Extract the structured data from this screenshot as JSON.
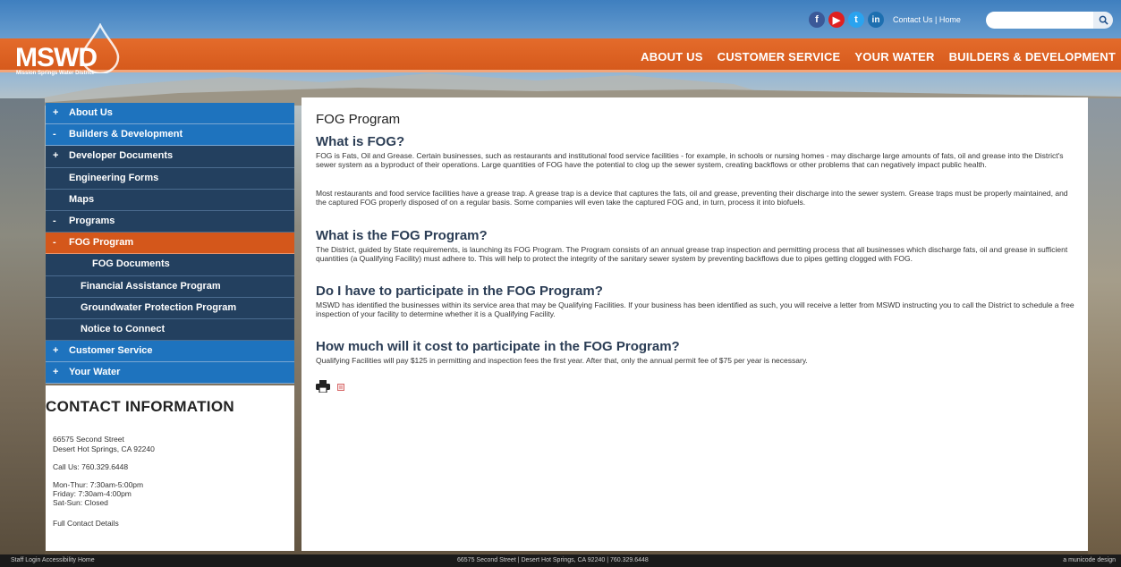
{
  "logo": {
    "main": "MSWD",
    "sub": "Mission Springs Water District"
  },
  "topbar": {
    "social": [
      "f",
      "▶",
      "t",
      "in"
    ],
    "contact_label": "Contact Us",
    "separator": "|",
    "home_label": "Home",
    "search_placeholder": ""
  },
  "nav": [
    "ABOUT US",
    "CUSTOMER SERVICE",
    "YOUR WATER",
    "BUILDERS & DEVELOPMENT"
  ],
  "sidebar": [
    {
      "mark": "+",
      "label": "About Us"
    },
    {
      "mark": "-",
      "label": "Builders & Development"
    },
    {
      "mark": "+",
      "label": "Developer Documents"
    },
    {
      "mark": "",
      "label": "Engineering Forms"
    },
    {
      "mark": "",
      "label": "Maps"
    },
    {
      "mark": "-",
      "label": "Programs"
    },
    {
      "mark": "-",
      "label": "FOG Program"
    },
    {
      "mark": "",
      "label": "FOG Documents"
    },
    {
      "mark": "",
      "label": "Financial Assistance Program"
    },
    {
      "mark": "",
      "label": "Groundwater Protection Program"
    },
    {
      "mark": "",
      "label": "Notice to Connect"
    },
    {
      "mark": "+",
      "label": "Customer Service"
    },
    {
      "mark": "+",
      "label": "Your Water"
    }
  ],
  "contact": {
    "title": "CONTACT INFORMATION",
    "address1": "66575 Second Street",
    "address2": "Desert Hot Springs, CA 92240",
    "phone": "Call Us: 760.329.6448",
    "hours1": "Mon-Thur: 7:30am-5:00pm",
    "hours2": "Friday: 7:30am-4:00pm",
    "hours3": "Sat-Sun: Closed",
    "details": "Full Contact Details"
  },
  "content": {
    "title": "FOG Program",
    "h1": "What is FOG?",
    "p1": "FOG is Fats, Oil and Grease. Certain businesses, such as restaurants and institutional food service facilities - for example, in schools or nursing homes - may discharge large amounts of fats, oil and grease into the District's sewer system as a byproduct of their operations. Large quantities of FOG have the potential to clog up the sewer system, creating backflows or other problems that can negatively impact public health.",
    "p2": "Most restaurants and food service facilities have a grease trap. A grease trap is a device that captures the fats, oil and grease, preventing their discharge into the sewer system. Grease traps must be properly maintained, and the captured FOG properly disposed of on a regular basis. Some companies will even take the captured FOG and, in turn, process it into biofuels.",
    "h2": "What is the FOG Program?",
    "p3": "The District, guided by State requirements, is launching its FOG Program. The Program consists of an annual grease trap inspection and permitting process that all businesses which discharge fats, oil and grease in sufficient quantities (a Qualifying Facility) must adhere to. This will help to protect the integrity of the sanitary sewer system by preventing backflows due to pipes getting clogged with FOG.",
    "h3": "Do I have to participate in the FOG Program?",
    "p4": "MSWD has identified the businesses within its service area that may be Qualifying Facilities. If your business has been identified as such, you will receive a letter from MSWD instructing you to call the District to schedule a free inspection of your facility to determine whether it is a Qualifying Facility.",
    "h4": "How much will it cost to participate in the FOG Program?",
    "p5": "Qualifying Facilities will pay $125 in permitting and inspection fees the first year. After that, only the annual permit fee of $75 per year is necessary."
  },
  "footer": {
    "left": "Staff Login   Accessibility   Home",
    "center": "66575 Second Street | Desert Hot Springs, CA 92240 | 760.329.6448",
    "right": "a municode design"
  }
}
